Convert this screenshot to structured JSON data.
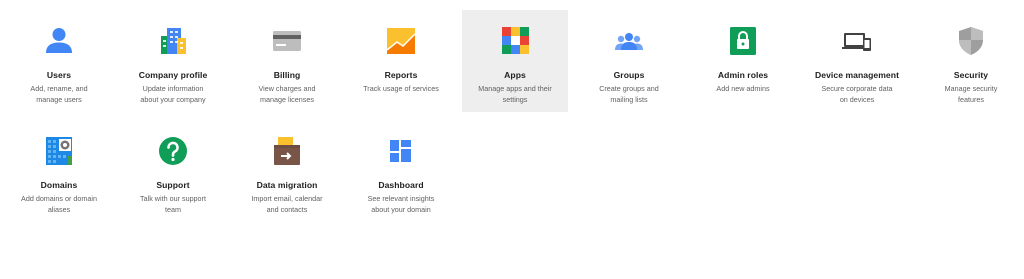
{
  "tiles": [
    {
      "id": "users",
      "title": "Users",
      "desc": "Add, rename, and\nmanage users",
      "icon": "person-icon"
    },
    {
      "id": "company-profile",
      "title": "Company profile",
      "desc": "Update information\nabout your company",
      "icon": "building-icon"
    },
    {
      "id": "billing",
      "title": "Billing",
      "desc": "View charges and\nmanage licenses",
      "icon": "credit-card-icon"
    },
    {
      "id": "reports",
      "title": "Reports",
      "desc": "Track usage of services",
      "icon": "chart-icon"
    },
    {
      "id": "apps",
      "title": "Apps",
      "desc": "Manage apps and their\nsettings",
      "icon": "apps-grid-icon"
    },
    {
      "id": "groups",
      "title": "Groups",
      "desc": "Create groups and\nmailing lists",
      "icon": "people-icon"
    },
    {
      "id": "admin-roles",
      "title": "Admin roles",
      "desc": "Add new admins",
      "icon": "lock-icon"
    },
    {
      "id": "device-management",
      "title": "Device management",
      "desc": "Secure corporate data\non devices",
      "icon": "devices-icon"
    },
    {
      "id": "security",
      "title": "Security",
      "desc": "Manage security\nfeatures",
      "icon": "shield-icon"
    },
    {
      "id": "domains",
      "title": "Domains",
      "desc": "Add domains or domain\naliases",
      "icon": "globe-building-icon"
    },
    {
      "id": "support",
      "title": "Support",
      "desc": "Talk with our support\nteam",
      "icon": "help-icon"
    },
    {
      "id": "data-migration",
      "title": "Data migration",
      "desc": "Import email, calendar\nand contacts",
      "icon": "archive-box-icon"
    },
    {
      "id": "dashboard",
      "title": "Dashboard",
      "desc": "See relevant insights\nabout your domain",
      "icon": "dashboard-icon"
    }
  ],
  "selected": "apps",
  "colors": {
    "blue": "#4285f4",
    "green": "#0f9d58",
    "yellow": "#fbc02d",
    "red": "#ea4335",
    "orange": "#f57c00"
  }
}
